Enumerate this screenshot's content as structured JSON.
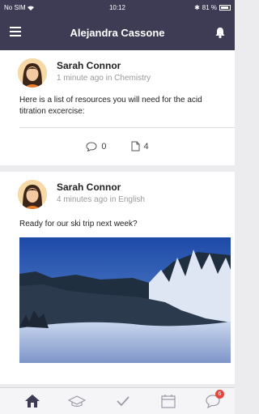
{
  "status_bar": {
    "carrier": "No SIM",
    "time": "10:12",
    "battery": "81 %"
  },
  "header": {
    "title": "Alejandra Cassone"
  },
  "posts": [
    {
      "author": "Sarah Connor",
      "time": "1 minute ago",
      "context": "in Chemistry",
      "text": "Here is a list of resources you will need for the acid titration excercise:",
      "comments": "0",
      "attachments": "4"
    },
    {
      "author": "Sarah Connor",
      "time": "4 minutes ago",
      "context": "in English",
      "text": "Ready for our ski trip next week?",
      "image": "snowy-forest-landscape"
    }
  ],
  "tab_bar": {
    "items": [
      "home-icon",
      "graduation-cap-icon",
      "checkmark-icon",
      "calendar-icon",
      "chat-icon"
    ],
    "chat_badge": "6"
  },
  "colors": {
    "header_bg": "#3d3c54",
    "badge": "#e8453c",
    "background": "#ececef"
  }
}
